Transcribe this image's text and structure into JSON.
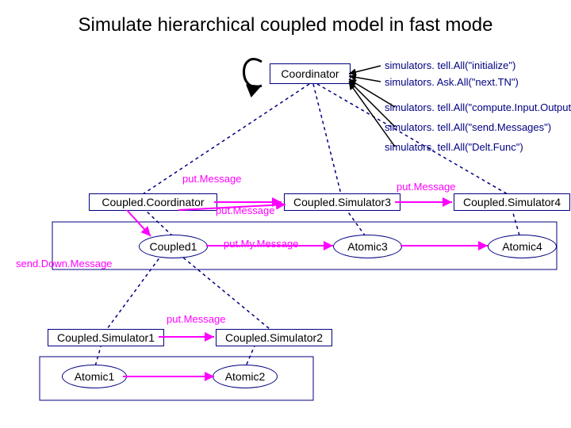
{
  "title": "Simulate hierarchical coupled model in fast mode",
  "nodes": {
    "coordinator": "Coordinator",
    "coupledCoordinator": "Coupled.Coordinator",
    "coupledSimulator3": "Coupled.Simulator3",
    "coupledSimulator4": "Coupled.Simulator4",
    "coupled1": "Coupled1",
    "atomic3": "Atomic3",
    "atomic4": "Atomic4",
    "coupledSimulator1": "Coupled.Simulator1",
    "coupledSimulator2": "Coupled.Simulator2",
    "atomic1": "Atomic1",
    "atomic2": "Atomic2"
  },
  "calls": {
    "c1": "simulators. tell.All(\"initialize\")",
    "c2": "simulators. Ask.All(\"next.TN\")",
    "c3": "simulators. tell.All(\"compute.Input.Output\")",
    "c4": "simulators. tell.All(\"send.Messages\")",
    "c5": "simulators. tell.All(\"Delt.Func\")"
  },
  "messages": {
    "putMessage": "put.Message",
    "putMyMessage": "put.My.Message",
    "sendDownMessage": "send.Down.Message"
  }
}
